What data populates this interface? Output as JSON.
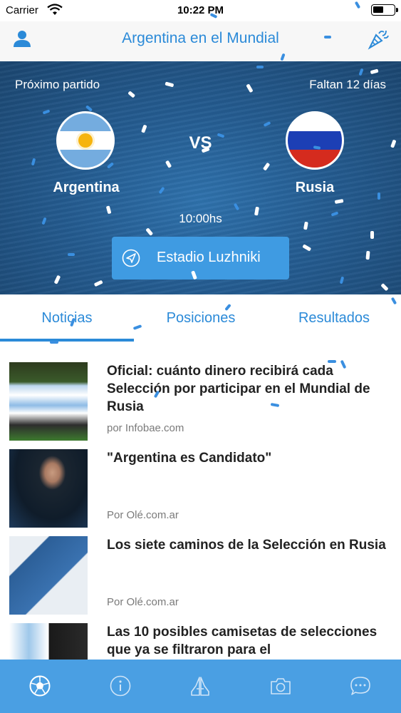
{
  "status_bar": {
    "carrier": "Carrier",
    "time": "10:22 PM"
  },
  "nav": {
    "title": "Argentina en el Mundial",
    "left_icon": "person-icon",
    "right_icon": "confetti-icon"
  },
  "hero": {
    "next_match_label": "Próximo partido",
    "days_left_label": "Faltan 12 días",
    "vs_label": "VS",
    "home_team": "Argentina",
    "away_team": "Rusia",
    "match_time": "10:00hs",
    "stadium": "Estadio Luzhniki"
  },
  "tabs": {
    "items": [
      "Noticias",
      "Posiciones",
      "Resultados"
    ],
    "selected": 0
  },
  "news": [
    {
      "title": "Oficial: cuánto dinero recibirá cada Selección por participar en el Mundial de Rusia",
      "source": "por Infobae.com"
    },
    {
      "title": "\"Argentina es Candidato\"",
      "source": "Por Olé.com.ar"
    },
    {
      "title": "Los siete caminos de la Selección en Rusia",
      "source": "Por Olé.com.ar"
    },
    {
      "title": "Las 10 posibles camisetas de selecciones que ya se filtraron para el",
      "source": ""
    }
  ],
  "tab_bar": {
    "icons": [
      "soccer-ball-icon",
      "info-icon",
      "praying-hands-icon",
      "camera-icon",
      "chat-bubble-icon"
    ],
    "selected": 0
  },
  "colors": {
    "accent": "#2b8ad8",
    "tab_bar": "#4a9fe3",
    "hero": "#245c91",
    "button": "#3f9be2"
  }
}
